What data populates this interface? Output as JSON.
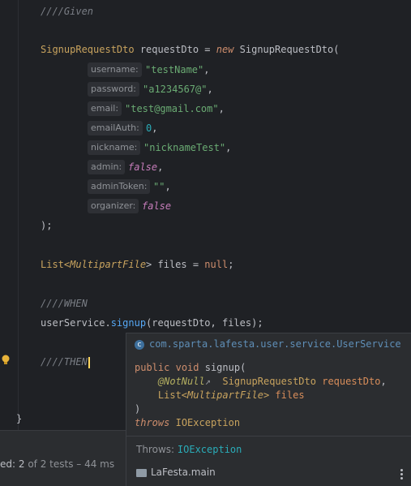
{
  "editor": {
    "comment_given": "////Given",
    "decl_type": "SignupRequestDto",
    "decl_var": " requestDto = ",
    "decl_new": "new",
    "decl_ctor": " SignupRequestDto(",
    "args": [
      {
        "hint": "username:",
        "value": "\"testName\"",
        "suffix": ","
      },
      {
        "hint": "password:",
        "value": "\"a1234567@\"",
        "suffix": ","
      },
      {
        "hint": "email:",
        "value": "\"test@gmail.com\"",
        "suffix": ","
      },
      {
        "hint": "emailAuth:",
        "value": "0",
        "suffix": ","
      },
      {
        "hint": "nickname:",
        "value": "\"nicknameTest\"",
        "suffix": ","
      },
      {
        "hint": "admin:",
        "value": "false",
        "suffix": ","
      },
      {
        "hint": "adminToken:",
        "value": "\"\"",
        "suffix": ","
      },
      {
        "hint": "organizer:",
        "value": "false",
        "suffix": ""
      }
    ],
    "close_paren": ");",
    "list_type": "List<",
    "list_generic": "MultipartFile",
    "list_rest": "> files = ",
    "list_null": "null",
    "list_end": ";",
    "comment_when": "////WHEN",
    "call_obj": "userService.",
    "call_method": "signup",
    "call_args": "(requestDto, files);",
    "comment_then": "////THEN",
    "closing_brace": "}"
  },
  "popup": {
    "class_path": "com.sparta.lafesta.user.service.UserService",
    "sig_public": "public",
    "sig_void": "void",
    "sig_name": "signup(",
    "sig_ann": "@NotNull",
    "sig_ann_arrow": "↗",
    "sig_p1_type": "SignupRequestDto",
    "sig_p1_name": "requestDto",
    "sig_p2_type_a": "List<",
    "sig_p2_type_b": "MultipartFile",
    "sig_p2_type_c": ">",
    "sig_p2_name": "files",
    "sig_close": ")",
    "sig_throws": "throws",
    "sig_exc": "IOException",
    "throws_label": "Throws:",
    "throws_value": "IOException",
    "module": "LaFesta.main"
  },
  "status": {
    "prefix": "ed: ",
    "passed": "2",
    "of_text": " of 2 tests – 44 ms"
  }
}
